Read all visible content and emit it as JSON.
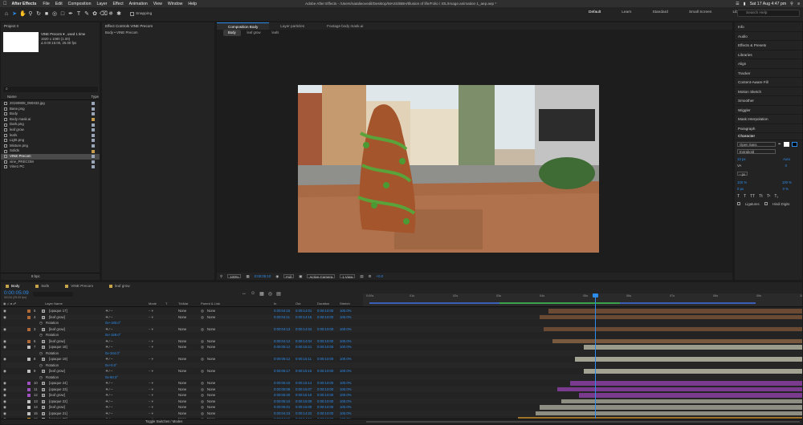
{
  "menubar": {
    "app_name": "After Effects",
    "items": [
      "File",
      "Edit",
      "Composition",
      "Layer",
      "Effect",
      "Animation",
      "View",
      "Window",
      "Help"
    ],
    "window_title": "Adobe After Effects - /Users/natalieovedil/Desktop/MASS/BBH/Illusion of life/Folio / IOL/Image.animation 1_aep.aep *",
    "clock": "Sat 17 Aug  4:47 pm"
  },
  "toolbar": {
    "snapping_label": "Snapping",
    "workspaces": [
      "Default",
      "Learn",
      "Standard",
      "Small Screen",
      "Libraries"
    ],
    "search_placeholder": "Search Help"
  },
  "project": {
    "tab": "Project ≡",
    "comp_name": "VINE Precom ▾ , used 1 time",
    "comp_info1": "1920 x 1080 (1.00)",
    "comp_info2": "Δ 0:00:15:00, 25.00 fps",
    "search_placeholder": "⌕",
    "col_name": "Name",
    "col_type": "Type",
    "items": [
      {
        "name": "20190808_090333.jpg",
        "color": "#9aa6b8"
      },
      {
        "name": "Base.png",
        "color": "#9aa6b8"
      },
      {
        "name": "Body",
        "color": "#9aa6b8"
      },
      {
        "name": "Body mask.ai",
        "color": "#c79c4a"
      },
      {
        "name": "Dark.png",
        "color": "#9aa6b8"
      },
      {
        "name": "leaf grow",
        "color": "#9aa6b8"
      },
      {
        "name": "leafs",
        "color": "#9aa6b8"
      },
      {
        "name": "Light.png",
        "color": "#9aa6b8"
      },
      {
        "name": "Mixture.png",
        "color": "#9aa6b8"
      },
      {
        "name": "Solids",
        "color": "#c79c4a"
      },
      {
        "name": "VINE Precom",
        "color": "#9aa6b8",
        "selected": true
      },
      {
        "name": "vine_PRECOM",
        "color": "#9aa6b8"
      },
      {
        "name": "Vine1 PC",
        "color": "#9aa6b8"
      }
    ],
    "footer": "8 bpc"
  },
  "effect_controls": {
    "tab": "Effect Controls VINE Precom",
    "subtitle": "Body • VINE Precom"
  },
  "composition": {
    "tabs": [
      "Composition Body",
      "Layer particles",
      "Footage body mask.ai"
    ],
    "sub_tabs": [
      "Body",
      "leaf grow",
      "leafs"
    ],
    "footer": {
      "zoom": "100%",
      "timecode": "0:00:05:10",
      "resolution": "Full",
      "camera": "Active Camera",
      "views": "1 View",
      "exposure": "+0.0"
    }
  },
  "right_panel": {
    "items": [
      "Info",
      "Audio",
      "Effects & Presets",
      "Libraries",
      "Align",
      "Tracker",
      "Content-Aware Fill",
      "Motion Sketch",
      "Smoother",
      "Wiggler",
      "Mask Interpolation",
      "Paragraph"
    ],
    "character": {
      "title": "Character",
      "font": "Open Sans",
      "style": "Extrabold",
      "size": "13 px",
      "leading": "Auto",
      "tracking": "0",
      "unit": "- px",
      "v_scale": "100 %",
      "h_scale": "100 %",
      "baseline": "0 px",
      "tsume": "0 %",
      "ligatures": "Ligatures",
      "hindi": "Hindi Digits"
    }
  },
  "timeline": {
    "tabs": [
      "Body",
      "leafs",
      "VINE Precom",
      "leaf grow"
    ],
    "timecode": "0:00:05:09",
    "frame_info": "00134 (25.00 fps)",
    "headers": [
      "Layer Name",
      "Mode",
      "T",
      "TrkMat",
      "Parent & Link",
      "In",
      "Out",
      "Duration",
      "Stretch"
    ],
    "ruler": [
      "0:00s",
      "01s",
      "02s",
      "03s",
      "04s",
      "05s",
      "06s",
      "07s",
      "08s",
      "09s",
      "10s"
    ],
    "rows": [
      {
        "num": "5",
        "name": "[opaque 17]",
        "kind": "layer",
        "mode": "None",
        "parent": "None",
        "in": "0:00:04:15",
        "out": "0:00:14:01",
        "dur": "0:00:10:00",
        "stretch": "100.0%",
        "label": "#b06a3a",
        "bar_start": 0.42,
        "bar_color": "#6b4a33"
      },
      {
        "num": "4",
        "name": "[leaf grow]",
        "kind": "layer",
        "mode": "None",
        "parent": "None",
        "in": "0:00:04:11",
        "out": "0:00:14:15",
        "dur": "0:00:10:00",
        "stretch": "100.0%",
        "label": "#b06a3a",
        "bar_start": 0.4,
        "bar_color": "#6b4a33"
      },
      {
        "kind": "sub",
        "name": "Rotation",
        "value": "0x+180.0°"
      },
      {
        "num": "3",
        "name": "[leaf grow]",
        "kind": "layer",
        "mode": "None",
        "parent": "None",
        "in": "0:00:04:13",
        "out": "0:00:14:04",
        "dur": "0:00:10:00",
        "stretch": "100.0%",
        "label": "#b06a3a",
        "bar_start": 0.41,
        "bar_color": "#6b4a33"
      },
      {
        "kind": "sub",
        "name": "Rotation",
        "value": "0x+159.0°"
      },
      {
        "num": "6",
        "name": "[leaf grow]",
        "kind": "layer",
        "mode": "None",
        "parent": "None",
        "in": "0:00:04:12",
        "out": "0:00:14:04",
        "dur": "0:00:10:00",
        "stretch": "100.0%",
        "label": "#b06a3a",
        "bar_start": 0.43,
        "bar_color": "#7a5a3f"
      },
      {
        "num": "7",
        "name": "[opaque 18]",
        "kind": "layer",
        "mode": "None",
        "parent": "None",
        "in": "0:00:05:12",
        "out": "0:00:15:21",
        "dur": "0:00:10:00",
        "stretch": "100.0%",
        "label": "#c0c0c0",
        "bar_start": 0.5,
        "bar_color": "#9c9c8c"
      },
      {
        "kind": "sub",
        "name": "Rotation",
        "value": "0x-344.0°"
      },
      {
        "num": "8",
        "name": "[opaque 19]",
        "kind": "layer",
        "mode": "None",
        "parent": "None",
        "in": "0:00:05:12",
        "out": "0:00:15:11",
        "dur": "0:00:10:00",
        "stretch": "100.0%",
        "label": "#c0c0c0",
        "bar_start": 0.48,
        "bar_color": "#a3a393"
      },
      {
        "kind": "sub",
        "name": "Rotation",
        "value": "0x+0.0°"
      },
      {
        "num": "9",
        "name": "[leaf grow]",
        "kind": "layer",
        "mode": "None",
        "parent": "None",
        "in": "0:00:05:17",
        "out": "0:00:15:16",
        "dur": "0:00:10:00",
        "stretch": "100.0%",
        "label": "#c0c0c0",
        "bar_start": 0.5,
        "bar_color": "#a3a393"
      },
      {
        "kind": "sub",
        "name": "Rotation",
        "value": "0x-60.0°"
      },
      {
        "num": "10",
        "name": "[opaque 24]",
        "kind": "layer",
        "mode": "None",
        "parent": "None",
        "in": "0:00:05:15",
        "out": "0:00:15:14",
        "dur": "0:00:10:00",
        "stretch": "100.0%",
        "label": "#a050c0",
        "bar_start": 0.47,
        "bar_color": "#7a3b8f"
      },
      {
        "num": "11",
        "name": "[opaque 23]",
        "kind": "layer",
        "mode": "None",
        "parent": "None",
        "in": "0:00:05:08",
        "out": "0:00:15:07",
        "dur": "0:00:10:00",
        "stretch": "100.0%",
        "label": "#a050c0",
        "bar_start": 0.44,
        "bar_color": "#7a3b8f"
      },
      {
        "num": "12",
        "name": "[leaf grow]",
        "kind": "layer",
        "mode": "None",
        "parent": "None",
        "in": "0:00:05:20",
        "out": "0:00:15:19",
        "dur": "0:00:10:00",
        "stretch": "100.0%",
        "label": "#a050c0",
        "bar_start": 0.49,
        "bar_color": "#7a3b8f"
      },
      {
        "num": "13",
        "name": "[opaque 22]",
        "kind": "layer",
        "mode": "None",
        "parent": "None",
        "in": "0:00:05:10",
        "out": "0:00:15:09",
        "dur": "0:00:10:00",
        "stretch": "100.0%",
        "label": "#c0c0c0",
        "bar_start": 0.45,
        "bar_color": "#8e8e82"
      },
      {
        "num": "14",
        "name": "[leaf grow]",
        "kind": "layer",
        "mode": "None",
        "parent": "None",
        "in": "0:00:05:01",
        "out": "0:00:15:00",
        "dur": "0:00:10:00",
        "stretch": "100.0%",
        "label": "#c0c0c0",
        "bar_start": 0.4,
        "bar_color": "#8e8e82"
      },
      {
        "num": "15",
        "name": "[opaque 21]",
        "kind": "layer",
        "mode": "None",
        "parent": "None",
        "in": "0:00:04:23",
        "out": "0:00:14:22",
        "dur": "0:00:10:00",
        "stretch": "100.0%",
        "label": "#c0c0c0",
        "bar_start": 0.39,
        "bar_color": "#8e8e82"
      },
      {
        "num": "16",
        "name": "[opaque 20]",
        "kind": "layer",
        "mode": "None",
        "parent": "None",
        "in": "0:00:04:15",
        "out": "0:00:14:12",
        "dur": "0:00:10:00",
        "stretch": "100.0%",
        "label": "#d49a2a",
        "bar_start": 0.35,
        "bar_color": "#a0742a"
      },
      {
        "kind": "sub",
        "name": "Rotation",
        "value": "0x+175.0°"
      },
      {
        "num": "18",
        "name": "[leaf grow]",
        "kind": "layer",
        "mode": "None",
        "parent": "None",
        "in": "0:00:02:19",
        "out": "0:00:12:18",
        "dur": "0:00:10:00",
        "stretch": "100.0%",
        "label": "#d49a2a",
        "bar_start": 0.3,
        "bar_color": "#a0742a"
      }
    ],
    "footer": "Toggle Switches / Modes"
  }
}
